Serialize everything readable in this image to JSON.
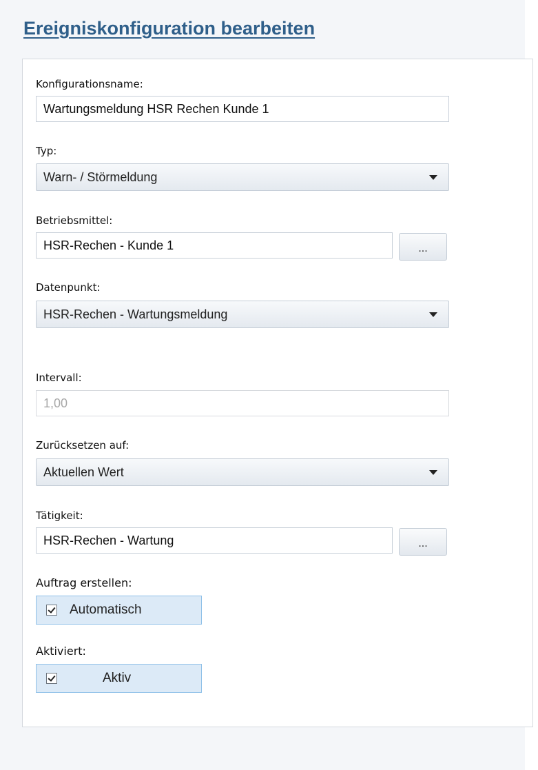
{
  "page": {
    "title": "Ereigniskonfiguration bearbeiten"
  },
  "form": {
    "config_name": {
      "label": "Konfigurationsname:",
      "value": "Wartungsmeldung HSR Rechen Kunde 1"
    },
    "type": {
      "label": "Typ:",
      "selected": "Warn- / Störmeldung"
    },
    "equipment": {
      "label": "Betriebsmittel:",
      "value": "HSR-Rechen - Kunde 1",
      "browse_label": "..."
    },
    "datapoint": {
      "label": "Datenpunkt:",
      "selected": "HSR-Rechen - Wartungsmeldung"
    },
    "interval": {
      "label": "Intervall:",
      "value": "1,00"
    },
    "reset_to": {
      "label": "Zurücksetzen auf:",
      "selected": "Aktuellen Wert"
    },
    "activity": {
      "label": "Tätigkeit:",
      "value": "HSR-Rechen - Wartung",
      "browse_label": "..."
    },
    "create_order": {
      "label": "Auftrag erstellen:",
      "checkbox_label": "Automatisch",
      "checked": true
    },
    "enabled": {
      "label": "Aktiviert:",
      "checkbox_label": "Aktiv",
      "checked": true
    }
  },
  "icons": {
    "dropdown": "chevron-down-icon",
    "checkbox": "checkmark-icon"
  },
  "colors": {
    "title": "#2f5f8a",
    "checkbox_bg": "#dceaf7",
    "checkbox_border": "#8fc0e8"
  }
}
